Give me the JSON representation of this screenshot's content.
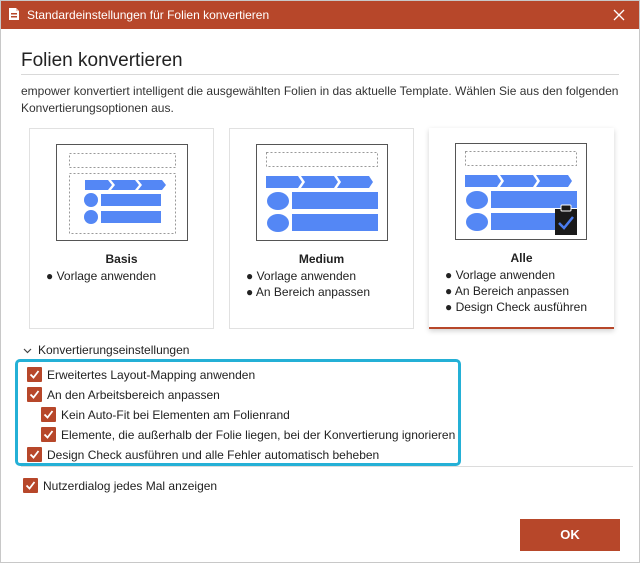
{
  "window": {
    "title": "Standardeinstellungen für Folien konvertieren",
    "accent_color": "#b7472a",
    "highlight_color": "#24b0d6",
    "thumb_shape_color": "#5487f5"
  },
  "header": {
    "title": "Folien konvertieren",
    "description": "empower konvertiert intelligent die ausgewählten Folien in das aktuelle Template. Wählen Sie aus den folgenden Konvertierungsoptionen aus."
  },
  "cards": [
    {
      "name": "Basis",
      "items": [
        "● Vorlage anwenden"
      ],
      "selected": false
    },
    {
      "name": "Medium",
      "items": [
        "● Vorlage anwenden",
        "● An Bereich anpassen"
      ],
      "selected": false
    },
    {
      "name": "Alle",
      "items": [
        "● Vorlage anwenden",
        "● An Bereich anpassen",
        "● Design Check ausführen"
      ],
      "selected": true
    }
  ],
  "settings": {
    "section_title": "Konvertierungseinstellungen",
    "options": [
      {
        "label": "Erweitertes Layout-Mapping anwenden",
        "checked": true
      },
      {
        "label": "An den Arbeitsbereich anpassen",
        "checked": true
      },
      {
        "label": "Kein Auto-Fit bei Elementen am Folienrand",
        "checked": true
      },
      {
        "label": "Elemente, die außerhalb der Folie liegen, bei der Konvertierung ignorieren",
        "checked": true
      },
      {
        "label": "Design Check ausführen und alle Fehler automatisch beheben",
        "checked": true
      }
    ],
    "show_dialog": {
      "label": "Nutzerdialog jedes Mal anzeigen",
      "checked": true
    }
  },
  "footer": {
    "ok_label": "OK"
  }
}
